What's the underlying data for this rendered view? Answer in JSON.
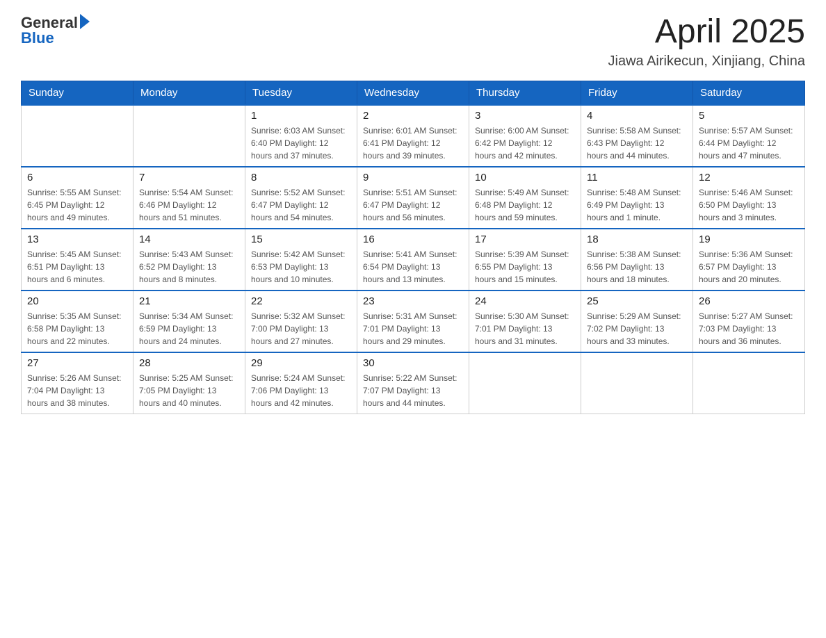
{
  "header": {
    "title": "April 2025",
    "subtitle": "Jiawa Airikecun, Xinjiang, China",
    "logo_line1": "General",
    "logo_line2": "Blue"
  },
  "days_of_week": [
    "Sunday",
    "Monday",
    "Tuesday",
    "Wednesday",
    "Thursday",
    "Friday",
    "Saturday"
  ],
  "weeks": [
    [
      {
        "day": "",
        "info": ""
      },
      {
        "day": "",
        "info": ""
      },
      {
        "day": "1",
        "info": "Sunrise: 6:03 AM\nSunset: 6:40 PM\nDaylight: 12 hours\nand 37 minutes."
      },
      {
        "day": "2",
        "info": "Sunrise: 6:01 AM\nSunset: 6:41 PM\nDaylight: 12 hours\nand 39 minutes."
      },
      {
        "day": "3",
        "info": "Sunrise: 6:00 AM\nSunset: 6:42 PM\nDaylight: 12 hours\nand 42 minutes."
      },
      {
        "day": "4",
        "info": "Sunrise: 5:58 AM\nSunset: 6:43 PM\nDaylight: 12 hours\nand 44 minutes."
      },
      {
        "day": "5",
        "info": "Sunrise: 5:57 AM\nSunset: 6:44 PM\nDaylight: 12 hours\nand 47 minutes."
      }
    ],
    [
      {
        "day": "6",
        "info": "Sunrise: 5:55 AM\nSunset: 6:45 PM\nDaylight: 12 hours\nand 49 minutes."
      },
      {
        "day": "7",
        "info": "Sunrise: 5:54 AM\nSunset: 6:46 PM\nDaylight: 12 hours\nand 51 minutes."
      },
      {
        "day": "8",
        "info": "Sunrise: 5:52 AM\nSunset: 6:47 PM\nDaylight: 12 hours\nand 54 minutes."
      },
      {
        "day": "9",
        "info": "Sunrise: 5:51 AM\nSunset: 6:47 PM\nDaylight: 12 hours\nand 56 minutes."
      },
      {
        "day": "10",
        "info": "Sunrise: 5:49 AM\nSunset: 6:48 PM\nDaylight: 12 hours\nand 59 minutes."
      },
      {
        "day": "11",
        "info": "Sunrise: 5:48 AM\nSunset: 6:49 PM\nDaylight: 13 hours\nand 1 minute."
      },
      {
        "day": "12",
        "info": "Sunrise: 5:46 AM\nSunset: 6:50 PM\nDaylight: 13 hours\nand 3 minutes."
      }
    ],
    [
      {
        "day": "13",
        "info": "Sunrise: 5:45 AM\nSunset: 6:51 PM\nDaylight: 13 hours\nand 6 minutes."
      },
      {
        "day": "14",
        "info": "Sunrise: 5:43 AM\nSunset: 6:52 PM\nDaylight: 13 hours\nand 8 minutes."
      },
      {
        "day": "15",
        "info": "Sunrise: 5:42 AM\nSunset: 6:53 PM\nDaylight: 13 hours\nand 10 minutes."
      },
      {
        "day": "16",
        "info": "Sunrise: 5:41 AM\nSunset: 6:54 PM\nDaylight: 13 hours\nand 13 minutes."
      },
      {
        "day": "17",
        "info": "Sunrise: 5:39 AM\nSunset: 6:55 PM\nDaylight: 13 hours\nand 15 minutes."
      },
      {
        "day": "18",
        "info": "Sunrise: 5:38 AM\nSunset: 6:56 PM\nDaylight: 13 hours\nand 18 minutes."
      },
      {
        "day": "19",
        "info": "Sunrise: 5:36 AM\nSunset: 6:57 PM\nDaylight: 13 hours\nand 20 minutes."
      }
    ],
    [
      {
        "day": "20",
        "info": "Sunrise: 5:35 AM\nSunset: 6:58 PM\nDaylight: 13 hours\nand 22 minutes."
      },
      {
        "day": "21",
        "info": "Sunrise: 5:34 AM\nSunset: 6:59 PM\nDaylight: 13 hours\nand 24 minutes."
      },
      {
        "day": "22",
        "info": "Sunrise: 5:32 AM\nSunset: 7:00 PM\nDaylight: 13 hours\nand 27 minutes."
      },
      {
        "day": "23",
        "info": "Sunrise: 5:31 AM\nSunset: 7:01 PM\nDaylight: 13 hours\nand 29 minutes."
      },
      {
        "day": "24",
        "info": "Sunrise: 5:30 AM\nSunset: 7:01 PM\nDaylight: 13 hours\nand 31 minutes."
      },
      {
        "day": "25",
        "info": "Sunrise: 5:29 AM\nSunset: 7:02 PM\nDaylight: 13 hours\nand 33 minutes."
      },
      {
        "day": "26",
        "info": "Sunrise: 5:27 AM\nSunset: 7:03 PM\nDaylight: 13 hours\nand 36 minutes."
      }
    ],
    [
      {
        "day": "27",
        "info": "Sunrise: 5:26 AM\nSunset: 7:04 PM\nDaylight: 13 hours\nand 38 minutes."
      },
      {
        "day": "28",
        "info": "Sunrise: 5:25 AM\nSunset: 7:05 PM\nDaylight: 13 hours\nand 40 minutes."
      },
      {
        "day": "29",
        "info": "Sunrise: 5:24 AM\nSunset: 7:06 PM\nDaylight: 13 hours\nand 42 minutes."
      },
      {
        "day": "30",
        "info": "Sunrise: 5:22 AM\nSunset: 7:07 PM\nDaylight: 13 hours\nand 44 minutes."
      },
      {
        "day": "",
        "info": ""
      },
      {
        "day": "",
        "info": ""
      },
      {
        "day": "",
        "info": ""
      }
    ]
  ]
}
